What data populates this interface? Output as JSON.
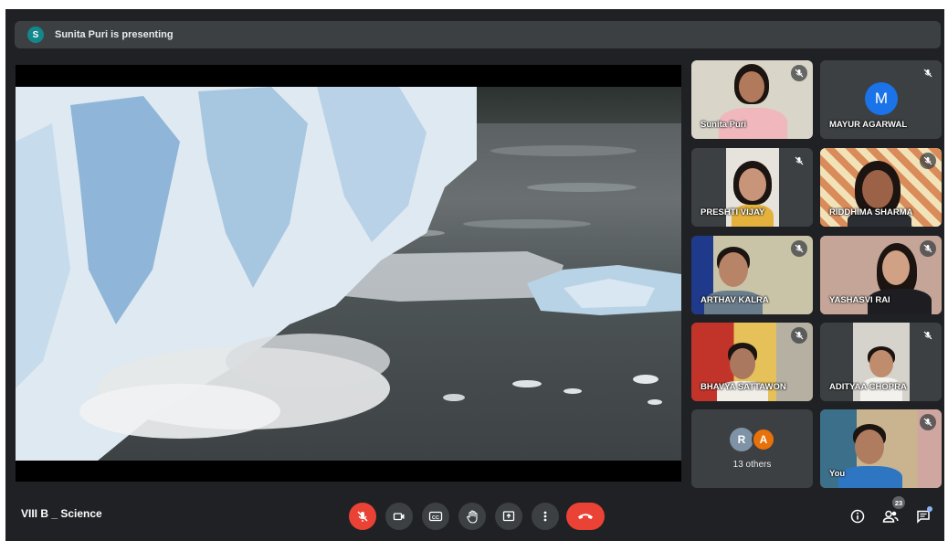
{
  "banner": {
    "avatar_letter": "S",
    "text": "Sunita Puri is presenting"
  },
  "participants": [
    {
      "name": "Sunita Puri",
      "muted": true
    },
    {
      "name": "MAYUR AGARWAL",
      "avatar_letter": "M",
      "muted": true
    },
    {
      "name": "PRESHTI VIJAY",
      "muted": true
    },
    {
      "name": "RIDDHIMA SHARMA",
      "muted": true
    },
    {
      "name": "ARTHAV KALRA",
      "muted": true
    },
    {
      "name": "YASHASVI RAI",
      "muted": true
    },
    {
      "name": "BHAVYA SATTAWON",
      "muted": true
    },
    {
      "name": "ADITYAA CHOPRA",
      "muted": true
    },
    {
      "name": "You",
      "muted": true
    }
  ],
  "others": {
    "letters": [
      "R",
      "A"
    ],
    "label": "13 others"
  },
  "footer": {
    "meeting_name": "VIII B _ Science",
    "people_count": "23"
  },
  "controls": [
    "mic-off-icon",
    "camera-icon",
    "captions-icon",
    "raise-hand-icon",
    "present-icon",
    "more-icon",
    "end-call-icon"
  ],
  "colors": {
    "background": "#202124",
    "tile": "#3c4043",
    "end_call": "#ea4335",
    "avatar_blue": "#1a73e8",
    "presenter_avatar": "#12878c"
  }
}
